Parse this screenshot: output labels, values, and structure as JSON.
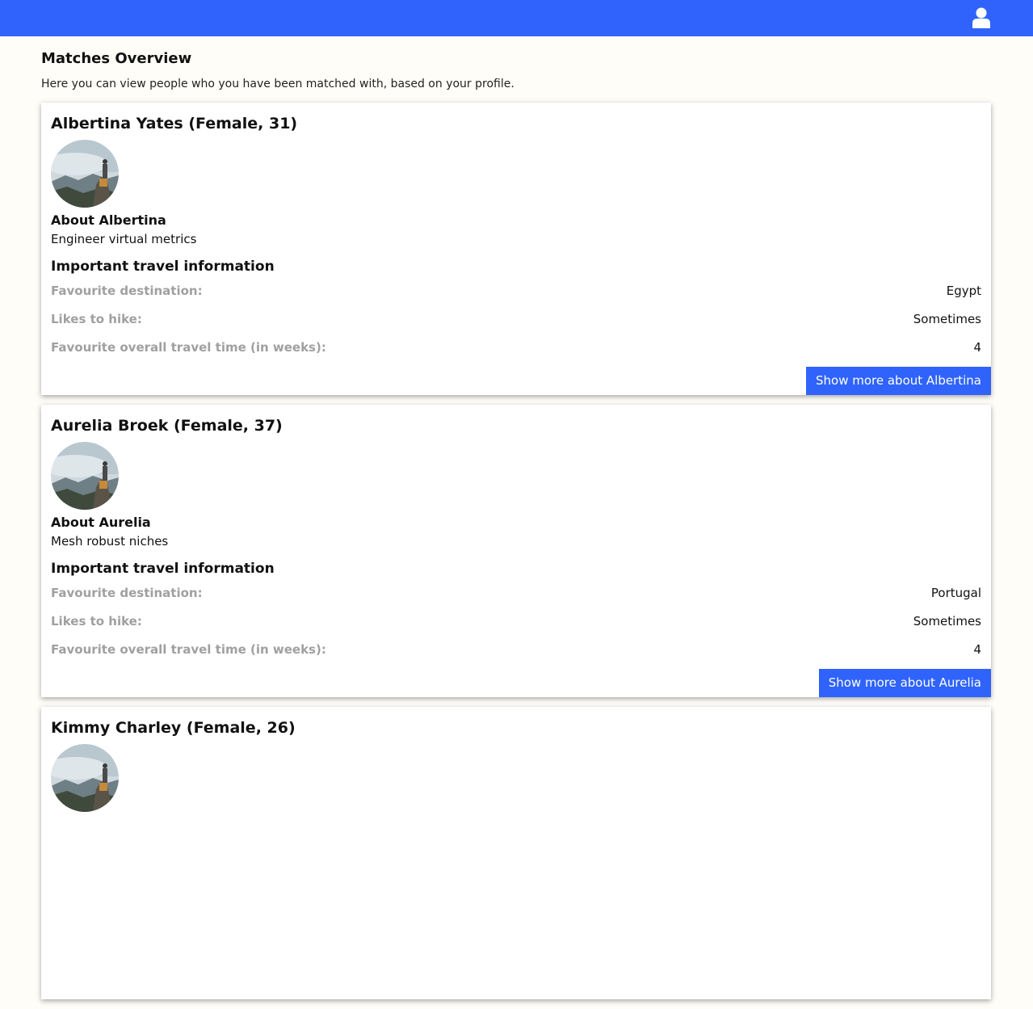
{
  "header": {
    "user_icon": "user-icon",
    "bar_color": "#2f63fb"
  },
  "page": {
    "title": "Matches Overview",
    "subtitle": "Here you can view people who you have been matched with, based on your profile."
  },
  "labels": {
    "travel_title": "Important travel information",
    "destination_label": "Favourite destination:",
    "hike_label": "Likes to hike:",
    "time_label": "Favourite overall travel time (in weeks):"
  },
  "matches": [
    {
      "name": "Albertina Yates (Female, 31)",
      "about_title": "About Albertina",
      "about_text": "Engineer virtual metrics",
      "destination": "Egypt",
      "hike": "Sometimes",
      "travel_time": "4",
      "button": "Show more about Albertina"
    },
    {
      "name": "Aurelia Broek (Female, 37)",
      "about_title": "About Aurelia",
      "about_text": "Mesh robust niches",
      "destination": "Portugal",
      "hike": "Sometimes",
      "travel_time": "4",
      "button": "Show more about Aurelia"
    },
    {
      "name": "Kimmy Charley (Female, 26)"
    }
  ]
}
